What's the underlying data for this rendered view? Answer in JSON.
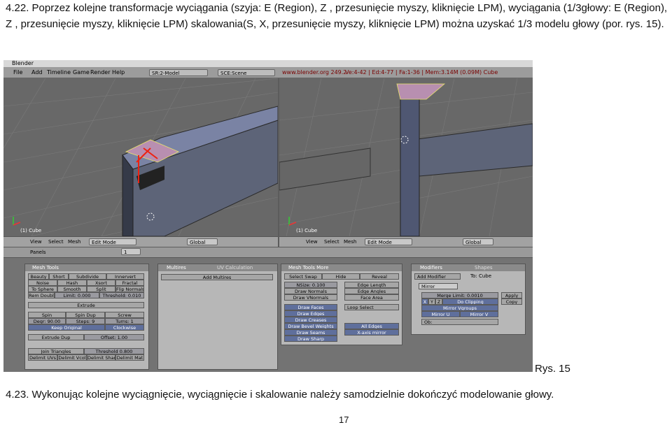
{
  "para1": "4.22.  Poprzez kolejne transformacje wyciągania (szyja: E (Region), Z , przesunięcie myszy, kliknięcie LPM), wyciągania (1/3głowy: E (Region), Z , przesunięcie myszy, kliknięcie LPM) skalowania(S, X, przesunięcie myszy, kliknięcie LPM) można uzyskać 1/3 modelu głowy (por.  rys. 15).",
  "caption": "Rys. 15",
  "para2": "4.23.   Wykonując kolejne wyciągnięcie, wyciągnięcie i skalowanie należy samodzielnie dokończyć modelowanie głowy.",
  "page_number": "17",
  "blender": {
    "title": "Blender",
    "menu": [
      "File",
      "Add",
      "Timeline",
      "Game",
      "Render",
      "Help"
    ],
    "screen": "SR:2-Model",
    "scene": "SCE:Scene",
    "site": "www.blender.org 249.2",
    "stats": "Ve:4-42 | Ed:4-77 | Fa:1-36 | Mem:3.14M (0.09M) Cube",
    "vp_label": "(1) Cube",
    "toolbar": {
      "view": "View",
      "select": "Select",
      "mesh": "Mesh",
      "mode": "Edit Mode",
      "orient": "Global"
    },
    "panels_label": "Panels",
    "panels_num": "1",
    "mesh_tools": {
      "title": "Mesh Tools",
      "row1": [
        "Beauty",
        "Short",
        "Subdivide",
        "Innervert"
      ],
      "row2": [
        "Noise",
        "Hash",
        "Xsort",
        "Fractal"
      ],
      "row3": [
        "To Sphere",
        "Smooth",
        "Split",
        "Flip Normals"
      ],
      "row4": [
        "Rem Doubl",
        "Limit: 0.000",
        "Threshold: 0.010"
      ],
      "extrude": "Extrude",
      "row5": [
        "Spin",
        "Spin Dup",
        "Screw"
      ],
      "row6": [
        "Degr: 90.00",
        "Steps: 9",
        "Turns: 1"
      ],
      "row7": [
        "Keep Original",
        "Clockwise"
      ],
      "row8": [
        "Extrude Dup",
        "Offset: 1.00"
      ],
      "row9": [
        "Join Triangles",
        "Threshold 0.800"
      ],
      "row10": [
        "Delimit UVs",
        "Delimit Vcol",
        "Delimit Sharp",
        "Delimit Mat"
      ]
    },
    "multires": {
      "tab1": "Multires",
      "tab2": "UV Calculation",
      "add": "Add Multires"
    },
    "mesh_tools_more": {
      "title": "Mesh Tools More",
      "row1": [
        "Select Swap",
        "Hide",
        "Reveal"
      ],
      "nsize": "NSize: 0.100",
      "edge_length": "Edge Length",
      "draw_normals": "Draw Normals",
      "edge_angles": "Edge Angles",
      "draw_vnormals": "Draw VNormals",
      "face_area": "Face Area",
      "draw_faces": "Draw Faces",
      "loop_select": "Loop Select",
      "draw_edges": "Draw Edges",
      "draw_creases": "Draw Creases",
      "draw_bevel": "Draw Bevel Weights",
      "all_edges": "All Edges",
      "draw_seams": "Draw Seams",
      "x_mirror": "X-axis mirror",
      "draw_sharp": "Draw Sharp"
    },
    "modifiers": {
      "tab1": "Modifiers",
      "tab2": "Shapes",
      "add": "Add Modifier",
      "to": "To: Cube",
      "mirror": "Mirror",
      "merge_limit": "Merge Limit: 0.0010",
      "xyz": [
        "X",
        "Y",
        "Z"
      ],
      "do_clipping": "Do Clipping",
      "mirror_vgroups": "Mirror Vgroups",
      "mirror_u": "Mirror U",
      "mirror_v": "Mirror V",
      "ob": "Ob:",
      "apply": "Apply",
      "copy": "Copy"
    }
  }
}
